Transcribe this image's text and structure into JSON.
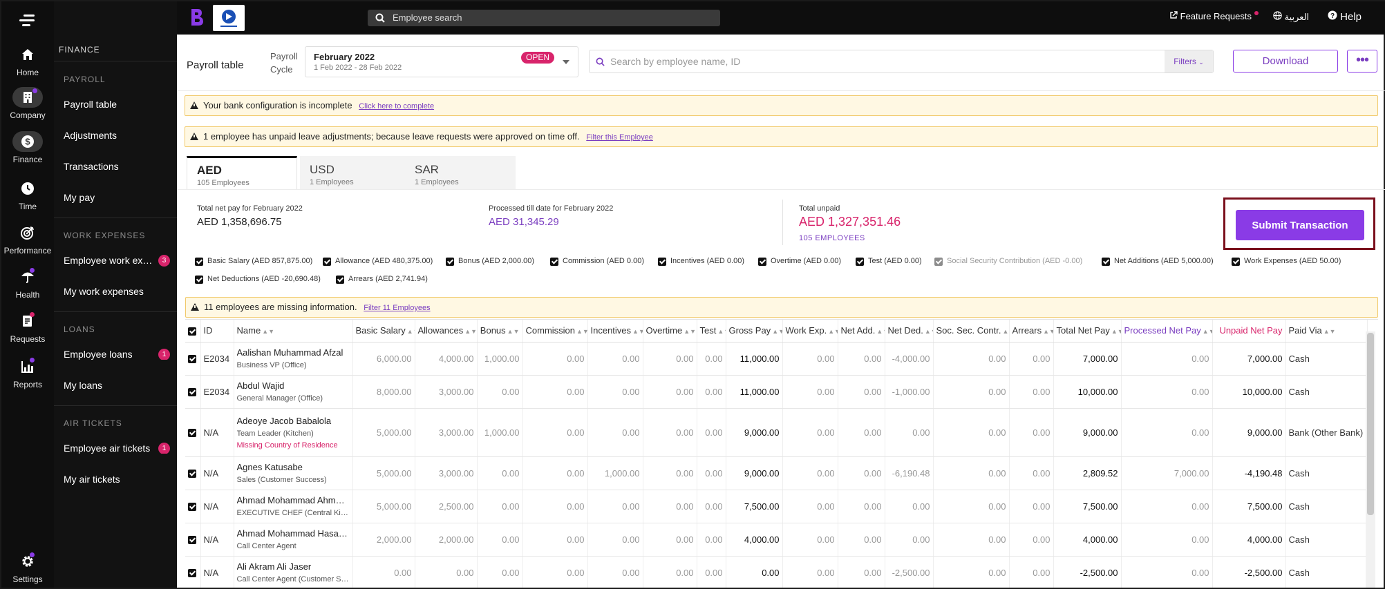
{
  "rail": {
    "items": [
      {
        "label": "Home",
        "icon": "home-icon"
      },
      {
        "label": "Company",
        "icon": "building-icon"
      },
      {
        "label": "Finance",
        "icon": "dollar-icon"
      },
      {
        "label": "Time",
        "icon": "clock-icon"
      },
      {
        "label": "Performance",
        "icon": "target-icon"
      },
      {
        "label": "Health",
        "icon": "umbrella-icon"
      },
      {
        "label": "Requests",
        "icon": "requests-icon"
      },
      {
        "label": "Reports",
        "icon": "chart-icon"
      },
      {
        "label": "Settings",
        "icon": "gear-icon"
      }
    ]
  },
  "sidebar": {
    "section": "FINANCE",
    "groups": {
      "payroll": "PAYROLL",
      "work_expenses": "WORK EXPENSES",
      "loans": "LOANS",
      "air_tickets": "AIR TICKETS"
    },
    "items": {
      "payroll_table": "Payroll table",
      "adjustments": "Adjustments",
      "transactions": "Transactions",
      "my_pay": "My pay",
      "employee_work_expenses": "Employee work expenses",
      "employee_work_expenses_badge": "3",
      "my_work_expenses": "My work expenses",
      "employee_loans": "Employee loans",
      "employee_loans_badge": "1",
      "my_loans": "My loans",
      "employee_air_tickets": "Employee air tickets",
      "employee_air_tickets_badge": "1",
      "my_air_tickets": "My air tickets"
    }
  },
  "topbar": {
    "search_placeholder": "Employee search",
    "feature_requests": "Feature Requests",
    "language": "العربية",
    "help": "Help"
  },
  "header": {
    "title": "Payroll table",
    "cycle_label_1": "Payroll",
    "cycle_label_2": "Cycle",
    "cycle_month": "February 2022",
    "cycle_range": "1 Feb 2022 - 28 Feb 2022",
    "cycle_status": "OPEN",
    "search_placeholder": "Search by employee name, ID",
    "filters_label": "Filters",
    "download_label": "Download",
    "more_label": "•••"
  },
  "alerts": {
    "bank": {
      "text": "Your bank configuration is incomplete",
      "link": "Click here to complete"
    },
    "leave": {
      "text": "1 employee has unpaid leave adjustments; because leave requests were approved on time off.",
      "link": "Filter this Employee"
    },
    "missing": {
      "text": "11 employees are missing information.",
      "link": "Filter 11 Employees"
    }
  },
  "currency_tabs": [
    {
      "code": "AED",
      "count": "105 Employees"
    },
    {
      "code": "USD",
      "count": "1 Employees"
    },
    {
      "code": "SAR",
      "count": "1 Employees"
    }
  ],
  "summary": {
    "net_pay_label": "Total net pay for February 2022",
    "net_pay_value": "AED 1,358,696.75",
    "processed_label": "Processed till date for February 2022",
    "processed_value": "AED 31,345.29",
    "unpaid_label": "Total unpaid",
    "unpaid_value": "AED 1,327,351.46",
    "unpaid_employees": "105 EMPLOYEES",
    "submit_label": "Submit Transaction"
  },
  "column_filters": [
    "Basic Salary (AED 857,875.00)",
    "Allowance (AED 480,375.00)",
    "Bonus (AED 2,000.00)",
    "Commission (AED 0.00)",
    "Incentives (AED 0.00)",
    "Overtime (AED 0.00)",
    "Test (AED 0.00)",
    "Social Security Contribution (AED -0.00)",
    "Net Additions (AED 5,000.00)",
    "Work Expenses (AED 50.00)",
    "Net Deductions (AED -20,690.48)",
    "Arrears (AED 2,741.94)"
  ],
  "table": {
    "headers": [
      "ID",
      "Name",
      "Basic Salary",
      "Allowances",
      "Bonus",
      "Commission",
      "Incentives",
      "Overtime",
      "Test",
      "Gross Pay",
      "Work Exp.",
      "Net Add.",
      "Net Ded.",
      "Soc. Sec. Contr.",
      "Arrears",
      "Total Net Pay",
      "Processed Net Pay",
      "Unpaid Net Pay",
      "Paid Via"
    ],
    "rows": [
      {
        "id": "E2034",
        "name": "Aalishan Muhammad Afzal",
        "role": "Business VP (Office)",
        "warning": "",
        "v": [
          "6,000.00",
          "4,000.00",
          "1,000.00",
          "0.00",
          "0.00",
          "0.00",
          "0.00",
          "11,000.00",
          "0.00",
          "0.00",
          "-4,000.00",
          "0.00",
          "0.00",
          "7,000.00",
          "0.00",
          "7,000.00"
        ],
        "paid_via": "Cash"
      },
      {
        "id": "E2034",
        "name": "Abdul Wajid",
        "role": "General Manager (Office)",
        "warning": "",
        "v": [
          "8,000.00",
          "3,000.00",
          "0.00",
          "0.00",
          "0.00",
          "0.00",
          "0.00",
          "11,000.00",
          "0.00",
          "0.00",
          "-1,000.00",
          "0.00",
          "0.00",
          "10,000.00",
          "0.00",
          "10,000.00"
        ],
        "paid_via": "Cash"
      },
      {
        "id": "N/A",
        "name": "Adeoye Jacob Babalola",
        "role": "Team Leader (Kitchen)",
        "warning": "Missing Country of Residence",
        "v": [
          "5,000.00",
          "3,000.00",
          "1,000.00",
          "0.00",
          "0.00",
          "0.00",
          "0.00",
          "9,000.00",
          "0.00",
          "0.00",
          "0.00",
          "0.00",
          "0.00",
          "9,000.00",
          "0.00",
          "9,000.00"
        ],
        "paid_via": "Bank (Other Bank)"
      },
      {
        "id": "N/A",
        "name": "Agnes Katusabe",
        "role": "Sales (Customer Success)",
        "warning": "",
        "v": [
          "5,000.00",
          "3,000.00",
          "0.00",
          "0.00",
          "1,000.00",
          "0.00",
          "0.00",
          "9,000.00",
          "0.00",
          "0.00",
          "-6,190.48",
          "0.00",
          "0.00",
          "2,809.52",
          "7,000.00",
          "-4,190.48"
        ],
        "paid_via": "Cash"
      },
      {
        "id": "N/A",
        "name": "Ahmad Mohammad Ahmad Alhaj",
        "role": "EXECUTIVE CHEF (Central Kitchen)",
        "warning": "",
        "v": [
          "5,000.00",
          "2,500.00",
          "0.00",
          "0.00",
          "0.00",
          "0.00",
          "0.00",
          "7,500.00",
          "0.00",
          "0.00",
          "0.00",
          "0.00",
          "0.00",
          "7,500.00",
          "0.00",
          "7,500.00"
        ],
        "paid_via": "Cash"
      },
      {
        "id": "N/A",
        "name": "Ahmad Mohammad Hasan Ali",
        "role": "Call Center Agent",
        "warning": "",
        "v": [
          "2,000.00",
          "2,000.00",
          "0.00",
          "0.00",
          "0.00",
          "0.00",
          "0.00",
          "4,000.00",
          "0.00",
          "0.00",
          "0.00",
          "0.00",
          "0.00",
          "4,000.00",
          "0.00",
          "4,000.00"
        ],
        "paid_via": "Cash"
      },
      {
        "id": "N/A",
        "name": "Ali Akram Ali Jaser",
        "role": "Call Center Agent (Customer Service)",
        "warning": "",
        "v": [
          "0.00",
          "0.00",
          "0.00",
          "0.00",
          "0.00",
          "0.00",
          "0.00",
          "0.00",
          "0.00",
          "0.00",
          "-2,500.00",
          "0.00",
          "0.00",
          "-2,500.00",
          "0.00",
          "-2,500.00"
        ],
        "paid_via": "Cash"
      }
    ]
  }
}
